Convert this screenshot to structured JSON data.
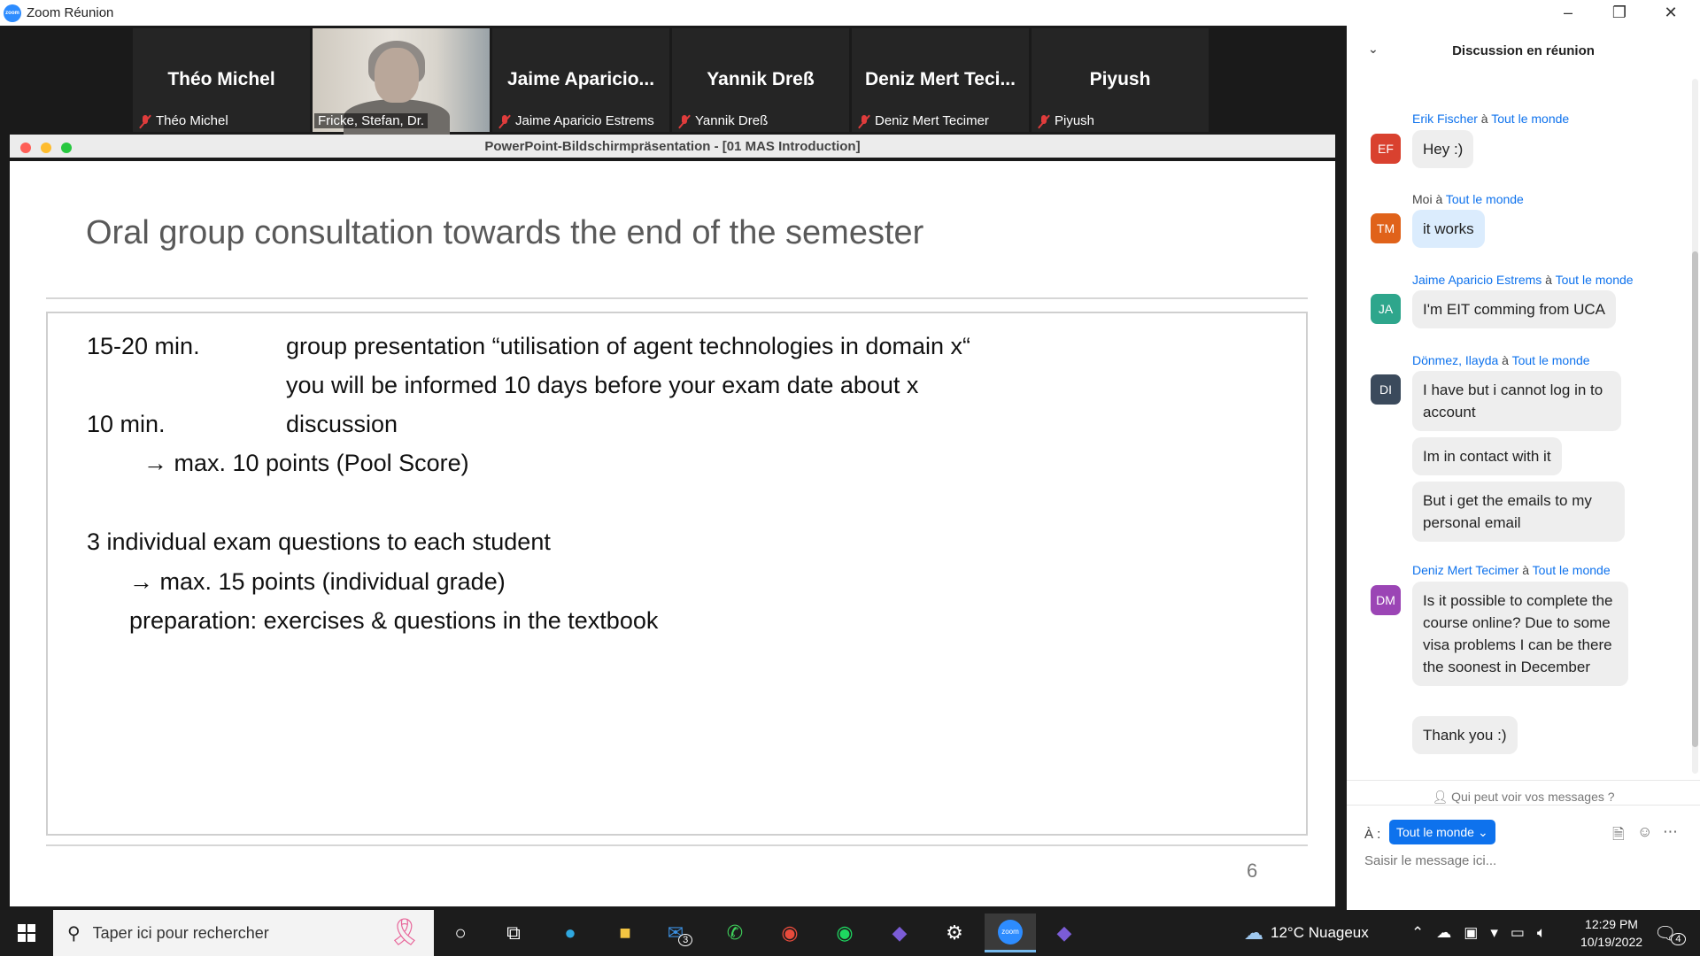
{
  "window": {
    "title": "Zoom Réunion",
    "app_icon_text": "zoom",
    "controls": [
      "–",
      "❐",
      "✕"
    ]
  },
  "participants": [
    {
      "big_name": "Théo Michel",
      "label": "Théo Michel",
      "muted": true
    },
    {
      "big_name": "",
      "label": "Fricke, Stefan, Dr.",
      "muted": false,
      "video": true
    },
    {
      "big_name": "Jaime  Aparicio...",
      "label": "Jaime Aparicio Estrems",
      "muted": true
    },
    {
      "big_name": "Yannik Dreß",
      "label": "Yannik Dreß",
      "muted": true
    },
    {
      "big_name": "Deniz  Mert  Teci...",
      "label": "Deniz Mert Tecimer",
      "muted": true
    },
    {
      "big_name": "Piyush",
      "label": "Piyush",
      "muted": true
    }
  ],
  "next_arrow": "›",
  "presentation": {
    "window_title": "PowerPoint-Bildschirmpräsentation - [01 MAS Introduction]",
    "slide_title": "Oral group consultation towards the end of the semester",
    "lines": [
      "15-20 min.",
      "group presentation “utilisation of agent technologies in domain x“",
      "you will be informed 10 days before your exam date about x",
      "10 min.",
      "discussion",
      "→  max. 10 points (Pool Score)",
      "3 individual exam questions to each student",
      "→  max. 15 points (individual grade)",
      "preparation: exercises & questions in the textbook"
    ],
    "page_number": "6"
  },
  "chat": {
    "header": "Discussion en réunion",
    "connector": "à",
    "recipient": "Tout le monde",
    "messages": [
      {
        "sender": "Erik Fischer",
        "initials": "EF",
        "color": "#d9412f",
        "text": "Hey :)"
      },
      {
        "sender": "Moi",
        "initials": "TM",
        "color": "#e0621a",
        "text": "it works",
        "mine": true
      },
      {
        "sender": "Jaime Aparicio Estrems",
        "initials": "JA",
        "color": "#2ea68c",
        "text": "I'm EIT comming from UCA"
      },
      {
        "sender": "Dönmez, Ilayda",
        "initials": "DI",
        "color": "#3b4a5c",
        "text": "I have but i cannot log in to account",
        "more": [
          "Im in contact with it",
          "But i get the emails to my personal email"
        ]
      },
      {
        "sender": "Deniz Mert Tecimer",
        "initials": "DM",
        "color": "#9b45b5",
        "text": "Is it possible to complete the course online? Due to some visa problems I can be there the soonest in December",
        "more": [
          "Thank you :)"
        ]
      }
    ],
    "who_can_see": "Qui peut voir vos messages ?",
    "to_label": "À :",
    "to_button": "Tout le monde",
    "input_placeholder": "Saisir le message ici..."
  },
  "taskbar": {
    "search_placeholder": "Taper ici pour rechercher",
    "mail_badge": "3",
    "weather": "12°C  Nuageux",
    "time": "12:29 PM",
    "date": "10/19/2022",
    "notification_count": "4"
  }
}
